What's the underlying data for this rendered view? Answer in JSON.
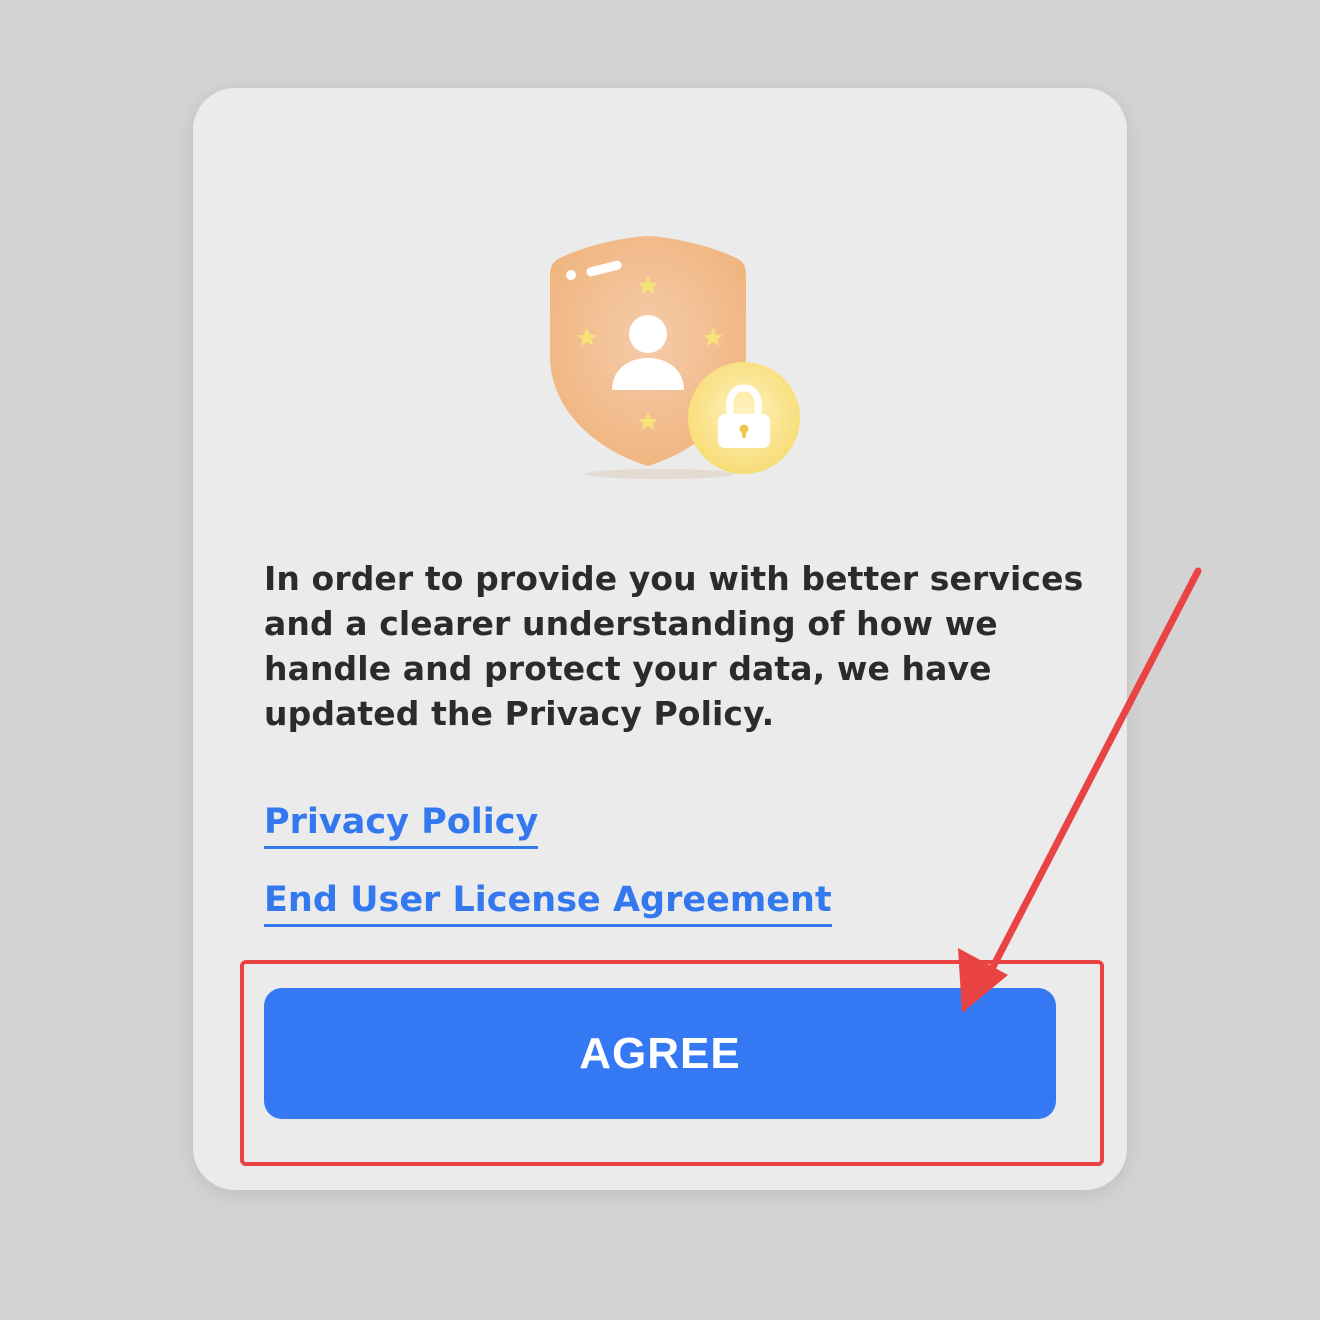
{
  "dialog": {
    "message": "In order to provide you with better services and a clearer understanding of how we handle and protect your data, we have updated the Privacy Policy.",
    "links": {
      "privacy_policy": "Privacy Policy",
      "eula": "End User License Agreement"
    },
    "agree_label": "AGREE",
    "illustration_icon": "shield-user-lock-icon"
  },
  "annotation": {
    "highlight_color": "#ea4343",
    "arrow_icon": "red-arrow-pointer"
  },
  "colors": {
    "accent": "#3478f3",
    "link": "#3478f0",
    "shield": "#f0b27a",
    "lock_badge": "#f7de7a"
  }
}
